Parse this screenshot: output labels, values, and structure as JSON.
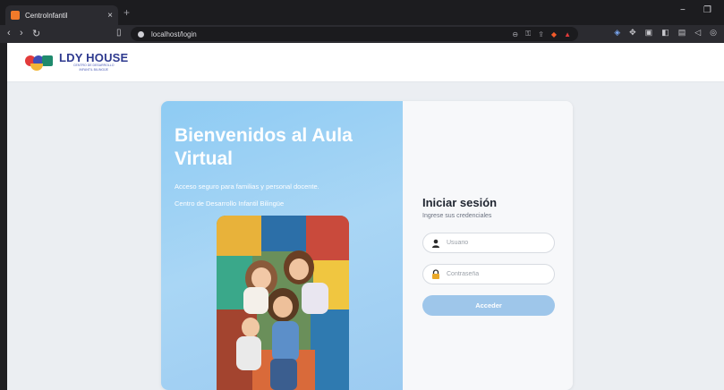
{
  "browser": {
    "tab_title": "CentroInfantil",
    "tab_close": "×",
    "new_tab": "+",
    "url": "localhost/login",
    "minimize": "−",
    "restore": "❐"
  },
  "header": {
    "logo_brand": "LDY HOUSE",
    "logo_sub1": "CENTRO DE DESARROLLO",
    "logo_sub2": "INFANTIL BILINGÜE"
  },
  "welcome": {
    "title": "Bienvenidos al Aula Virtual",
    "subtitle": "Acceso seguro para familias y personal docente.",
    "center": "Centro de Desarrollo Infantil Bilingüe"
  },
  "login": {
    "title": "Iniciar sesión",
    "subtitle": "Ingrese sus credenciales",
    "user_placeholder": "Usuario",
    "pass_placeholder": "Contraseña",
    "submit": "Acceder"
  },
  "colors": {
    "panel_gradient": "#8ecbf3",
    "button": "#9ec6ea",
    "brand": "#2e3a8f"
  },
  "icons": {
    "user_field": "user-icon",
    "pass_field": "lock-icon"
  }
}
